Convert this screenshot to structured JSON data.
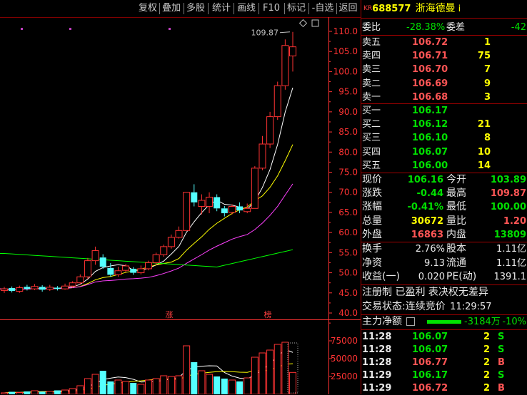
{
  "toolbar": {
    "buttons": [
      "复权",
      "叠加",
      "多股",
      "统计",
      "画线",
      "F10",
      "标记",
      "-自选",
      "返回"
    ]
  },
  "stock": {
    "market_tag": "KR",
    "code": "688577",
    "name": "浙海德曼",
    "name_suffix": "i"
  },
  "order_ratio": {
    "label1": "委比",
    "value1": "-28.38%",
    "label2": "委差",
    "value2": "-42"
  },
  "asks": [
    {
      "label": "卖五",
      "price": "106.72",
      "vol": "1"
    },
    {
      "label": "卖四",
      "price": "106.71",
      "vol": "75"
    },
    {
      "label": "卖三",
      "price": "106.70",
      "vol": "7"
    },
    {
      "label": "卖二",
      "price": "106.69",
      "vol": "9"
    },
    {
      "label": "卖一",
      "price": "106.68",
      "vol": "3"
    }
  ],
  "bids": [
    {
      "label": "买一",
      "price": "106.17",
      "vol": ""
    },
    {
      "label": "买二",
      "price": "106.12",
      "vol": "21"
    },
    {
      "label": "买三",
      "price": "106.10",
      "vol": "8"
    },
    {
      "label": "买四",
      "price": "106.07",
      "vol": "10"
    },
    {
      "label": "买五",
      "price": "106.00",
      "vol": "14"
    }
  ],
  "quote": [
    {
      "l1": "现价",
      "v1": "106.16",
      "c1": "green",
      "l2": "今开",
      "v2": "103.89",
      "c2": "green"
    },
    {
      "l1": "涨跌",
      "v1": "-0.44",
      "c1": "green",
      "l2": "最高",
      "v2": "109.87",
      "c2": "red"
    },
    {
      "l1": "涨幅",
      "v1": "-0.41%",
      "c1": "green",
      "l2": "最低",
      "v2": "100.00",
      "c2": "green"
    },
    {
      "l1": "总量",
      "v1": "30672",
      "c1": "yellow",
      "l2": "量比",
      "v2": "1.20",
      "c2": "red"
    },
    {
      "l1": "外盘",
      "v1": "16863",
      "c1": "red",
      "l2": "内盘",
      "v2": "13809",
      "c2": "green"
    }
  ],
  "fundamentals": [
    {
      "l1": "换手",
      "v1": "2.76%",
      "l2": "股本",
      "v2": "1.11亿"
    },
    {
      "l1": "净资",
      "v1": "9.13",
      "l2": "流通",
      "v2": "1.11亿"
    },
    {
      "l1": "收益(一)",
      "v1": "0.020",
      "l2": "PE(动)",
      "v2": "1391.1"
    }
  ],
  "tags_line": "注册制 已盈利 表决权无差异",
  "trade_status": {
    "label": "交易状态:",
    "value": "连续竞价",
    "time": "11:29:57"
  },
  "capital_flow": {
    "label": "主力净额",
    "value": "-3184万",
    "pct": "-10%"
  },
  "ticks": [
    {
      "time": "11:28",
      "price": "106.07",
      "price_color": "green",
      "vol": "2",
      "side": "S"
    },
    {
      "time": "11:28",
      "price": "106.07",
      "price_color": "green",
      "vol": "2",
      "side": "S"
    },
    {
      "time": "11:28",
      "price": "106.77",
      "price_color": "red",
      "vol": "2",
      "side": "B"
    },
    {
      "time": "11:29",
      "price": "106.17",
      "price_color": "green",
      "vol": "2",
      "side": "S"
    },
    {
      "time": "11:29",
      "price": "106.72",
      "price_color": "red",
      "vol": "2",
      "side": "B"
    }
  ],
  "colors": {
    "up": "#ff3333",
    "down": "#54ffff",
    "ma5": "#ffffff",
    "ma10": "#ffff00",
    "ma20": "#ff40ff",
    "ma60": "#00ff00",
    "axis": "#ff3333"
  },
  "chart_data": {
    "type": "candlestick",
    "price_axis": {
      "min": 40,
      "max": 110,
      "ticks": [
        "110.0",
        "105.0",
        "100.0",
        "95.0",
        "90.0",
        "85.0",
        "80.0",
        "75.0",
        "70.0",
        "65.0",
        "60.0",
        "55.0",
        "50.0",
        "45.0",
        "40.0"
      ]
    },
    "volume_axis": {
      "max": 75000,
      "ticks": [
        "75000",
        "50000",
        "25000"
      ]
    },
    "high_annotation": "109.87",
    "event_markers": [
      "涨",
      "榜"
    ],
    "candles": [
      {
        "o": 45.6,
        "c": 46.0,
        "h": 46.5,
        "l": 45.0,
        "v": 2000
      },
      {
        "o": 46.2,
        "c": 45.5,
        "h": 46.6,
        "l": 45.1,
        "v": 3500
      },
      {
        "o": 45.4,
        "c": 46.3,
        "h": 46.8,
        "l": 45.0,
        "v": 2500
      },
      {
        "o": 46.5,
        "c": 46.0,
        "h": 47.0,
        "l": 45.6,
        "v": 4000
      },
      {
        "o": 46.0,
        "c": 46.6,
        "h": 47.2,
        "l": 45.7,
        "v": 5000
      },
      {
        "o": 46.5,
        "c": 45.8,
        "h": 46.9,
        "l": 45.3,
        "v": 3500
      },
      {
        "o": 45.9,
        "c": 46.4,
        "h": 47.0,
        "l": 45.5,
        "v": 4000
      },
      {
        "o": 46.3,
        "c": 46.0,
        "h": 46.7,
        "l": 45.6,
        "v": 5500
      },
      {
        "o": 46.0,
        "c": 46.7,
        "h": 47.3,
        "l": 45.8,
        "v": 6000
      },
      {
        "o": 46.7,
        "c": 47.5,
        "h": 47.9,
        "l": 46.3,
        "v": 8000
      },
      {
        "o": 47.5,
        "c": 49.0,
        "h": 49.6,
        "l": 47.1,
        "v": 12000
      },
      {
        "o": 49.0,
        "c": 53.0,
        "h": 53.7,
        "l": 48.5,
        "v": 22000
      },
      {
        "o": 53.0,
        "c": 55.5,
        "h": 56.5,
        "l": 52.0,
        "v": 28000
      },
      {
        "o": 53.8,
        "c": 51.5,
        "h": 54.6,
        "l": 51.0,
        "v": 33000
      },
      {
        "o": 51.2,
        "c": 49.5,
        "h": 52.4,
        "l": 49.0,
        "v": 18000
      },
      {
        "o": 49.5,
        "c": 50.5,
        "h": 51.5,
        "l": 49.0,
        "v": 20000
      },
      {
        "o": 50.6,
        "c": 51.7,
        "h": 52.2,
        "l": 50.1,
        "v": 18000
      },
      {
        "o": 51.0,
        "c": 50.0,
        "h": 51.4,
        "l": 49.5,
        "v": 16000
      },
      {
        "o": 50.0,
        "c": 51.0,
        "h": 51.8,
        "l": 49.6,
        "v": 14000
      },
      {
        "o": 51.0,
        "c": 52.5,
        "h": 53.0,
        "l": 50.6,
        "v": 20000
      },
      {
        "o": 52.5,
        "c": 54.5,
        "h": 55.0,
        "l": 52.0,
        "v": 22000
      },
      {
        "o": 54.5,
        "c": 56.5,
        "h": 57.0,
        "l": 54.0,
        "v": 26000
      },
      {
        "o": 56.5,
        "c": 58.8,
        "h": 59.5,
        "l": 56.0,
        "v": 25000
      },
      {
        "o": 58.8,
        "c": 60.5,
        "h": 61.5,
        "l": 58.5,
        "v": 26000
      },
      {
        "o": 60.5,
        "c": 70.0,
        "h": 70.0,
        "l": 60.5,
        "v": 68000
      },
      {
        "o": 70.0,
        "c": 67.5,
        "h": 72.0,
        "l": 66.5,
        "v": 45000
      },
      {
        "o": 66.5,
        "c": 68.0,
        "h": 69.5,
        "l": 64.5,
        "v": 33000
      },
      {
        "o": 66.5,
        "c": 68.8,
        "h": 70.0,
        "l": 64.8,
        "v": 28000
      },
      {
        "o": 68.8,
        "c": 66.0,
        "h": 69.5,
        "l": 65.3,
        "v": 25000
      },
      {
        "o": 66.0,
        "c": 64.8,
        "h": 66.6,
        "l": 64.0,
        "v": 22000
      },
      {
        "o": 65.0,
        "c": 66.5,
        "h": 67.0,
        "l": 64.5,
        "v": 20000
      },
      {
        "o": 66.5,
        "c": 65.5,
        "h": 67.5,
        "l": 64.8,
        "v": 18000
      },
      {
        "o": 65.2,
        "c": 66.0,
        "h": 67.2,
        "l": 64.8,
        "v": 23000
      },
      {
        "o": 66.0,
        "c": 76.0,
        "h": 76.5,
        "l": 66.0,
        "v": 52000
      },
      {
        "o": 76.0,
        "c": 82.0,
        "h": 84.0,
        "l": 75.5,
        "v": 58000
      },
      {
        "o": 82.0,
        "c": 88.8,
        "h": 90.0,
        "l": 81.0,
        "v": 62000
      },
      {
        "o": 88.8,
        "c": 96.5,
        "h": 97.5,
        "l": 88.0,
        "v": 70000
      },
      {
        "o": 96.5,
        "c": 106.5,
        "h": 108.0,
        "l": 95.5,
        "v": 73000
      },
      {
        "o": 103.9,
        "c": 106.16,
        "h": 109.87,
        "l": 100.0,
        "v": 30672
      }
    ]
  }
}
